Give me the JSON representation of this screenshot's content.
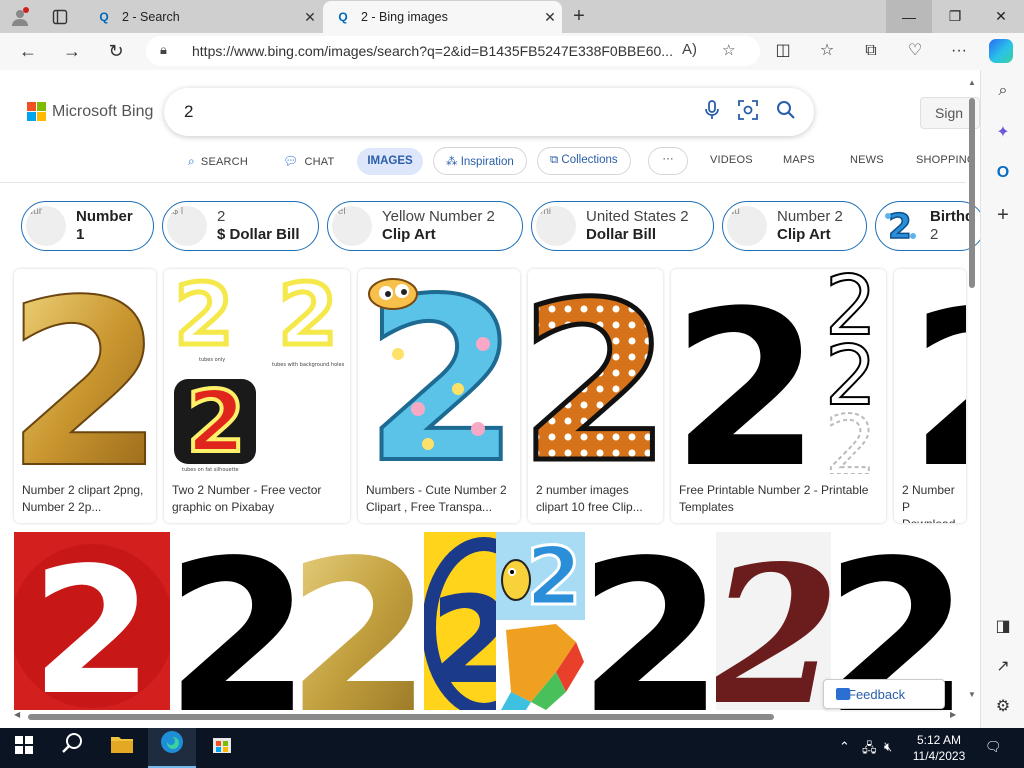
{
  "browser": {
    "tabs": [
      {
        "title": "2 - Search",
        "active": false
      },
      {
        "title": "2 - Bing images",
        "active": true
      }
    ],
    "url": "https://www.bing.com/images/search?q=2&id=B1435FB5247E338F0BBE60..."
  },
  "bing": {
    "logo": "Microsoft Bing",
    "query": "2",
    "signin": "Sign",
    "nav": {
      "search": "SEARCH",
      "chat": "CHAT",
      "images": "IMAGES",
      "inspiration": "Inspiration",
      "collections": "Collections",
      "more": "···",
      "videos": "VIDEOS",
      "maps": "MAPS",
      "news": "NEWS",
      "shopping": "SHOPPING"
    },
    "chips": [
      {
        "alt": "Nur",
        "line1": "Number",
        "line2": "1"
      },
      {
        "alt": "2$ l",
        "line1": "2",
        "line2": "$ Dollar Bill"
      },
      {
        "alt": "Yel",
        "line1": "Yellow Number 2",
        "line2": "Clip Art"
      },
      {
        "alt": "Uni",
        "line1": "United States 2",
        "line2": "Dollar Bill"
      },
      {
        "alt": "Nu",
        "line1": "Number 2",
        "line2": "Clip Art"
      },
      {
        "alt": "",
        "line1": "Birthd",
        "line2": "2"
      }
    ],
    "results_row1": [
      {
        "caption": "Number 2 clipart 2png, Number 2 2p..."
      },
      {
        "caption": "Two 2 Number - Free vector graphic on Pixabay",
        "sub_labels": [
          "tubes only",
          "tubes with background holes",
          "tubes on fat silhouette"
        ]
      },
      {
        "caption": "Numbers - Cute Number 2 Clipart , Free Transpa..."
      },
      {
        "caption": "2 number images clipart 10 free Clip..."
      },
      {
        "caption": "Free Printable Number 2 - Printable Templates"
      },
      {
        "caption": "2 Number P Download |"
      }
    ],
    "feedback": "Feedback"
  },
  "taskbar": {
    "time": "5:12 AM",
    "date": "11/4/2023"
  },
  "colors": {
    "accent": "#2a5ea8",
    "chip_border": "#1e6fb8",
    "tabbar": "#cfcfcf",
    "taskbar": "#0a1422"
  }
}
